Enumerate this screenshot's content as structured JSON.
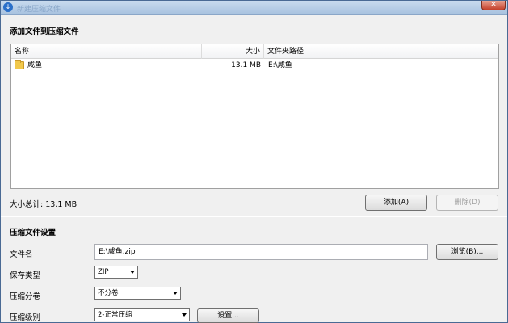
{
  "window": {
    "title": "新建压缩文件",
    "close_glyph": "✕",
    "app_icon_glyph": "↓"
  },
  "add_section": {
    "title": "添加文件到压缩文件",
    "columns": [
      "名称",
      "大小",
      "文件夹路径"
    ],
    "rows": [
      {
        "name": "咸鱼",
        "size": "13.1 MB",
        "path": "E:\\咸鱼",
        "icon": "folder-icon"
      }
    ],
    "total_size": "大小总计: 13.1 MB",
    "add_button": "添加(A)",
    "delete_button": "删除(D)"
  },
  "settings_section": {
    "title": "压缩文件设置",
    "filename_label": "文件名",
    "filename_value": "E:\\咸鱼.zip",
    "browse_button": "浏览(B)...",
    "type_label": "保存类型",
    "type_value": "ZIP",
    "split_label": "压缩分卷",
    "split_value": "不分卷",
    "level_label": "压缩级别",
    "level_value": "2-正常压缩",
    "settings_button": "设置..."
  }
}
